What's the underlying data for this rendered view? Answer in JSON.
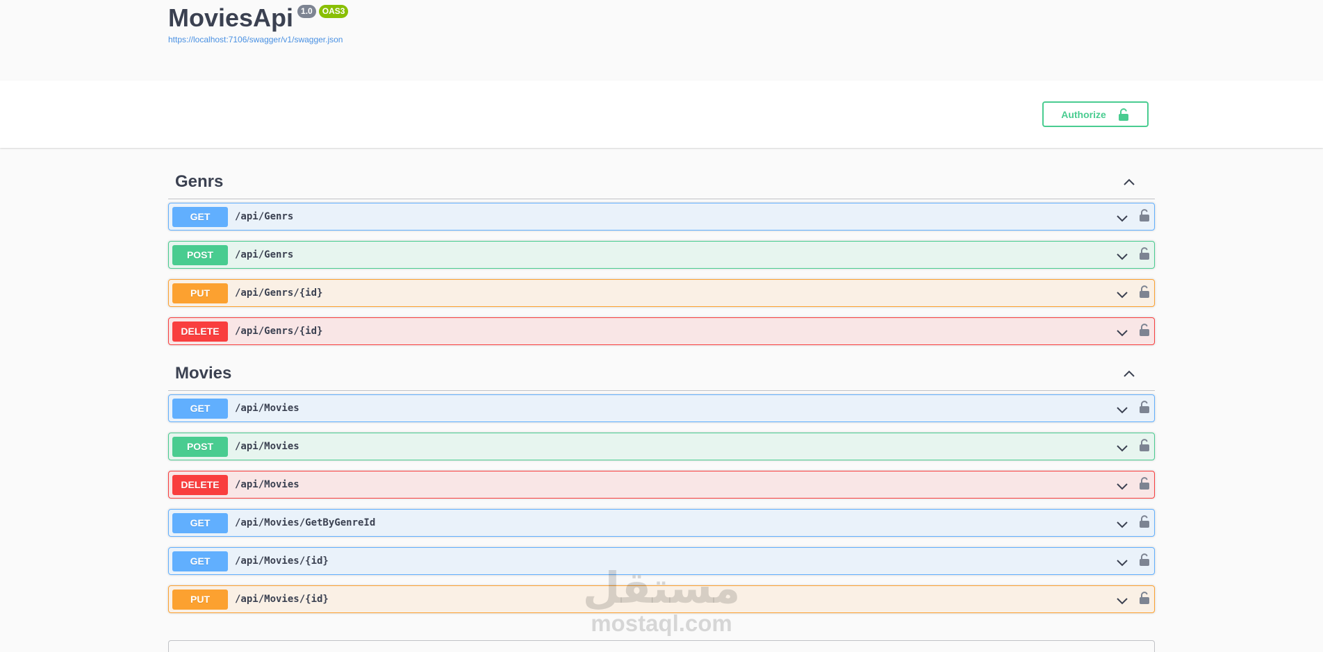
{
  "info": {
    "title": "MoviesApi",
    "version": "1.0",
    "oas_badge": "OAS3",
    "spec_url": "https://localhost:7106/swagger/v1/swagger.json"
  },
  "authorize": {
    "label": "Authorize",
    "icon": "unlock-icon"
  },
  "tags": [
    {
      "name": "Genrs",
      "operations": [
        {
          "method": "GET",
          "path": "/api/Genrs"
        },
        {
          "method": "POST",
          "path": "/api/Genrs"
        },
        {
          "method": "PUT",
          "path": "/api/Genrs/{id}"
        },
        {
          "method": "DELETE",
          "path": "/api/Genrs/{id}"
        }
      ]
    },
    {
      "name": "Movies",
      "operations": [
        {
          "method": "GET",
          "path": "/api/Movies"
        },
        {
          "method": "POST",
          "path": "/api/Movies"
        },
        {
          "method": "DELETE",
          "path": "/api/Movies"
        },
        {
          "method": "GET",
          "path": "/api/Movies/GetByGenreId"
        },
        {
          "method": "GET",
          "path": "/api/Movies/{id}"
        },
        {
          "method": "PUT",
          "path": "/api/Movies/{id}"
        }
      ]
    }
  ],
  "watermark": {
    "arabic": "مستقل",
    "latin": "mostaql.com"
  },
  "colors": {
    "get": "#61affe",
    "post": "#49cc90",
    "put": "#fca130",
    "delete": "#f93e3e",
    "authorize": "#49cc90",
    "text": "#3b4151"
  }
}
